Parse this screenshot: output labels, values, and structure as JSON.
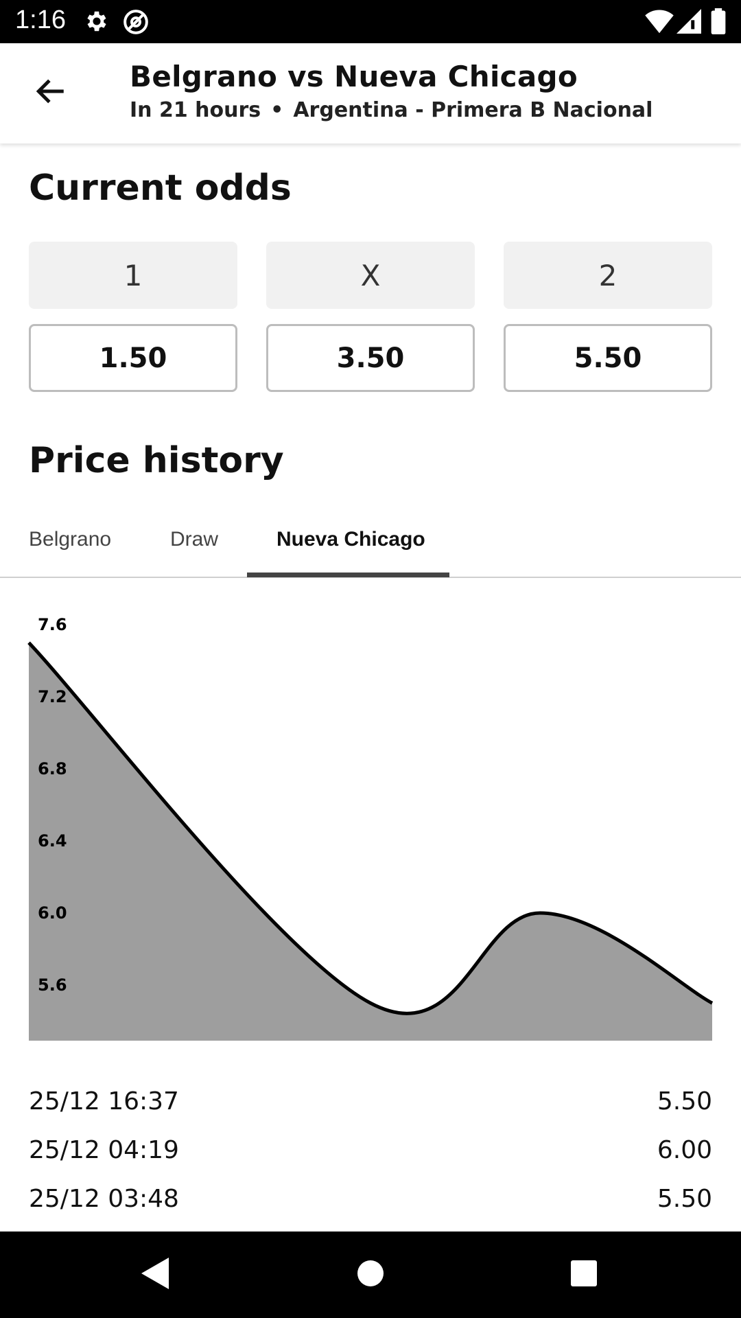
{
  "status_bar": {
    "time": "1:16",
    "icons": [
      "gear-icon",
      "at-sign-icon",
      "wifi-icon",
      "cell-signal-icon",
      "battery-icon"
    ]
  },
  "header": {
    "title": "Belgrano vs Nueva Chicago",
    "time_until": "In 21 hours",
    "separator": "•",
    "league": "Argentina - Primera B Nacional",
    "back_icon": "arrow-left-icon"
  },
  "current_odds": {
    "heading": "Current odds",
    "options": [
      {
        "label": "1",
        "value": "1.50"
      },
      {
        "label": "X",
        "value": "3.50"
      },
      {
        "label": "2",
        "value": "5.50"
      }
    ]
  },
  "price_history": {
    "heading": "Price history",
    "tabs": [
      {
        "label": "Belgrano",
        "active": false
      },
      {
        "label": "Draw",
        "active": false
      },
      {
        "label": "Nueva Chicago",
        "active": true
      }
    ],
    "entries": [
      {
        "time": "25/12 16:37",
        "price": "5.50"
      },
      {
        "time": "25/12 04:19",
        "price": "6.00"
      },
      {
        "time": "25/12 03:48",
        "price": "5.50"
      }
    ]
  },
  "chart_data": {
    "type": "area",
    "y_ticks": [
      "7.6",
      "7.2",
      "6.8",
      "6.4",
      "6.0",
      "5.6"
    ],
    "ylim": [
      5.3,
      7.6
    ],
    "series": [
      {
        "values": [
          7.5,
          5.5,
          6.0,
          5.5
        ]
      }
    ],
    "grid": false,
    "colors": {
      "fill": "#9e9e9e",
      "line": "#000000"
    }
  },
  "colors": {
    "tab_indicator": "#444444",
    "odds_label_bg": "#f1f1f1",
    "odds_border": "#bdbdbd"
  },
  "nav_bar": {
    "icons": [
      "back-triangle-icon",
      "home-circle-icon",
      "recents-square-icon"
    ]
  }
}
